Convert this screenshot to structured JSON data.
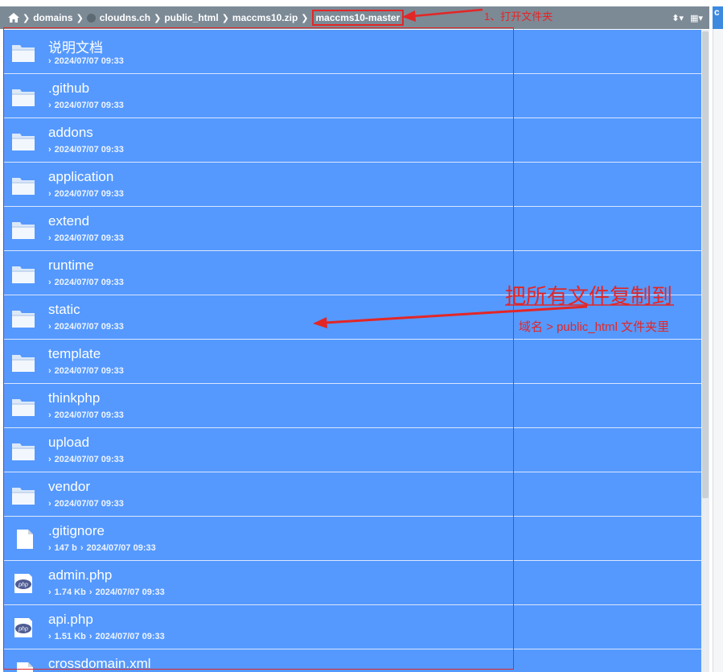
{
  "breadcrumb": {
    "items": [
      "domains",
      "cloudns.ch",
      "public_html",
      "maccms10.zip"
    ],
    "current": "maccms10-master"
  },
  "toolbar": {
    "sort_icon": "sort-icon",
    "view_icon": "grid-view-icon"
  },
  "right_panel": {
    "partial_label": "c"
  },
  "files": [
    {
      "name": "说明文档",
      "type": "folder",
      "meta": [
        "2024/07/07 09:33"
      ]
    },
    {
      "name": ".github",
      "type": "folder",
      "meta": [
        "2024/07/07 09:33"
      ]
    },
    {
      "name": "addons",
      "type": "folder",
      "meta": [
        "2024/07/07 09:33"
      ]
    },
    {
      "name": "application",
      "type": "folder",
      "meta": [
        "2024/07/07 09:33"
      ]
    },
    {
      "name": "extend",
      "type": "folder",
      "meta": [
        "2024/07/07 09:33"
      ]
    },
    {
      "name": "runtime",
      "type": "folder",
      "meta": [
        "2024/07/07 09:33"
      ]
    },
    {
      "name": "static",
      "type": "folder",
      "meta": [
        "2024/07/07 09:33"
      ]
    },
    {
      "name": "template",
      "type": "folder",
      "meta": [
        "2024/07/07 09:33"
      ]
    },
    {
      "name": "thinkphp",
      "type": "folder",
      "meta": [
        "2024/07/07 09:33"
      ]
    },
    {
      "name": "upload",
      "type": "folder",
      "meta": [
        "2024/07/07 09:33"
      ]
    },
    {
      "name": "vendor",
      "type": "folder",
      "meta": [
        "2024/07/07 09:33"
      ]
    },
    {
      "name": ".gitignore",
      "type": "file",
      "meta": [
        "147 b",
        "2024/07/07 09:33"
      ]
    },
    {
      "name": "admin.php",
      "type": "php",
      "meta": [
        "1.74 Kb",
        "2024/07/07 09:33"
      ]
    },
    {
      "name": "api.php",
      "type": "php",
      "meta": [
        "1.51 Kb",
        "2024/07/07 09:33"
      ]
    },
    {
      "name": "crossdomain.xml",
      "type": "file",
      "meta": []
    }
  ],
  "annotations": {
    "step1": "1、打开文件夹",
    "main": "把所有文件复制到",
    "sub": "域名 > public_html 文件夹里",
    "color": "#e32626"
  },
  "colors": {
    "list_bg": "#5599ff",
    "topbar_bg": "#7c8a96"
  }
}
